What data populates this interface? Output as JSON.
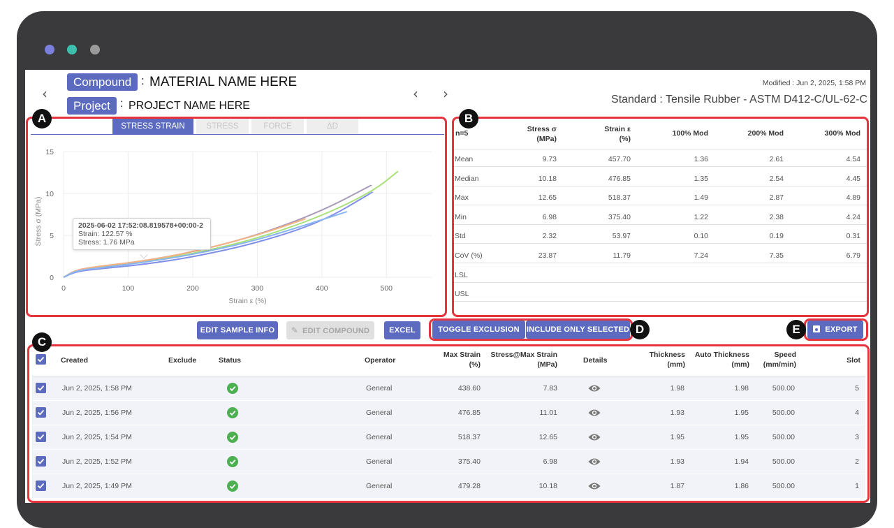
{
  "window": {
    "dots": [
      "#7b7fdc",
      "#3dbfae",
      "#9a9a9a"
    ]
  },
  "header": {
    "compound_label": "Compound",
    "compound_sep": ":",
    "compound_value": "MATERIAL NAME HERE",
    "project_label": "Project",
    "project_sep": ":",
    "project_value": "PROJECT NAME HERE",
    "modified": "Modified : Jun 2, 2025, 1:58 PM",
    "standard": "Standard : Tensile Rubber - ASTM D412-C/UL-62-C"
  },
  "annotations": [
    "A",
    "B",
    "C",
    "D",
    "E"
  ],
  "chart_tabs": [
    "STRESS STRAIN",
    "STRESS",
    "FORCE",
    "ΔD"
  ],
  "chart_data": {
    "type": "line",
    "xlabel": "Strain ε (%)",
    "ylabel": "Stress σ (MPa)",
    "xlim": [
      0,
      570
    ],
    "ylim": [
      0,
      15
    ],
    "xticks": [
      0,
      100,
      200,
      300,
      400,
      500
    ],
    "yticks": [
      0,
      5,
      10,
      15
    ],
    "grid": true,
    "series": [
      {
        "color": "#a8e07a",
        "points": [
          [
            0,
            0
          ],
          [
            20,
            0.9
          ],
          [
            60,
            1.3
          ],
          [
            120,
            1.8
          ],
          [
            200,
            2.8
          ],
          [
            300,
            4.6
          ],
          [
            400,
            7.3
          ],
          [
            480,
            10.3
          ],
          [
            518,
            12.65
          ]
        ]
      },
      {
        "color": "#a89ab8",
        "points": [
          [
            0,
            0
          ],
          [
            20,
            0.9
          ],
          [
            60,
            1.35
          ],
          [
            120,
            1.9
          ],
          [
            200,
            3.0
          ],
          [
            300,
            5.0
          ],
          [
            400,
            7.9
          ],
          [
            477,
            11.0
          ]
        ]
      },
      {
        "color": "#f4b183",
        "points": [
          [
            0,
            0
          ],
          [
            20,
            0.9
          ],
          [
            60,
            1.35
          ],
          [
            120,
            1.9
          ],
          [
            200,
            3.0
          ],
          [
            300,
            5.0
          ],
          [
            375,
            6.98
          ]
        ]
      },
      {
        "color": "#7f8ee8",
        "points": [
          [
            0,
            0
          ],
          [
            20,
            0.7
          ],
          [
            60,
            1.05
          ],
          [
            120,
            1.5
          ],
          [
            200,
            2.4
          ],
          [
            300,
            4.1
          ],
          [
            400,
            6.6
          ],
          [
            479,
            10.18
          ]
        ]
      },
      {
        "color": "#8ab6f0",
        "points": [
          [
            0,
            0
          ],
          [
            20,
            0.8
          ],
          [
            60,
            1.15
          ],
          [
            122.57,
            1.76
          ],
          [
            200,
            2.7
          ],
          [
            300,
            4.4
          ],
          [
            439,
            7.83
          ]
        ]
      }
    ],
    "tooltip": {
      "title": "2025-06-02 17:52:08.819578+00:00-2",
      "strain": "Strain: 122.57 %",
      "stress": "Stress: 1.76 MPa",
      "x": 122.57,
      "y": 1.76
    }
  },
  "stats": {
    "n_label": "n=5",
    "columns": [
      {
        "line1": "Stress σ",
        "line2": "(MPa)"
      },
      {
        "line1": "Strain ε",
        "line2": "(%)"
      },
      {
        "line1": "100% Mod",
        "line2": ""
      },
      {
        "line1": "200% Mod",
        "line2": ""
      },
      {
        "line1": "300% Mod",
        "line2": ""
      }
    ],
    "rows": [
      {
        "label": "Mean",
        "values": [
          "9.73",
          "457.70",
          "1.36",
          "2.61",
          "4.54"
        ]
      },
      {
        "label": "Median",
        "values": [
          "10.18",
          "476.85",
          "1.35",
          "2.54",
          "4.45"
        ]
      },
      {
        "label": "Max",
        "values": [
          "12.65",
          "518.37",
          "1.49",
          "2.87",
          "4.89"
        ]
      },
      {
        "label": "Min",
        "values": [
          "6.98",
          "375.40",
          "1.22",
          "2.38",
          "4.24"
        ]
      },
      {
        "label": "Std",
        "values": [
          "2.32",
          "53.97",
          "0.10",
          "0.19",
          "0.31"
        ]
      },
      {
        "label": "CoV (%)",
        "values": [
          "23.87",
          "11.79",
          "7.24",
          "7.35",
          "6.79"
        ]
      },
      {
        "label": "LSL",
        "values": [
          "",
          "",
          "",
          "",
          ""
        ]
      },
      {
        "label": "USL",
        "values": [
          "",
          "",
          "",
          "",
          ""
        ]
      }
    ]
  },
  "actions": {
    "edit_sample_info": "EDIT SAMPLE INFO",
    "edit_compound": "EDIT COMPOUND",
    "excel": "EXCEL",
    "toggle_exclusion": "TOGGLE EXCLUSION",
    "include_only_selected": "INCLUDE ONLY SELECTED",
    "export": "EXPORT"
  },
  "samples": {
    "columns": {
      "created": "Created",
      "exclude": "Exclude",
      "status": "Status",
      "operator": "Operator",
      "max_strain": [
        "Max Strain",
        "(%)"
      ],
      "stress_at_max": [
        "Stress@Max Strain",
        "(MPa)"
      ],
      "details": "Details",
      "thickness": [
        "Thickness",
        "(mm)"
      ],
      "auto_thickness": [
        "Auto Thickness",
        "(mm)"
      ],
      "speed": [
        "Speed",
        "(mm/min)"
      ],
      "slot": "Slot"
    },
    "rows": [
      {
        "created": "Jun 2, 2025, 1:58 PM",
        "operator": "General",
        "max_strain": "438.60",
        "stress": "7.83",
        "thickness": "1.98",
        "auto_thickness": "1.98",
        "speed": "500.00",
        "slot": "5"
      },
      {
        "created": "Jun 2, 2025, 1:56 PM",
        "operator": "General",
        "max_strain": "476.85",
        "stress": "11.01",
        "thickness": "1.93",
        "auto_thickness": "1.95",
        "speed": "500.00",
        "slot": "4"
      },
      {
        "created": "Jun 2, 2025, 1:54 PM",
        "operator": "General",
        "max_strain": "518.37",
        "stress": "12.65",
        "thickness": "1.95",
        "auto_thickness": "1.95",
        "speed": "500.00",
        "slot": "3"
      },
      {
        "created": "Jun 2, 2025, 1:52 PM",
        "operator": "General",
        "max_strain": "375.40",
        "stress": "6.98",
        "thickness": "1.93",
        "auto_thickness": "1.94",
        "speed": "500.00",
        "slot": "2"
      },
      {
        "created": "Jun 2, 2025, 1:49 PM",
        "operator": "General",
        "max_strain": "479.28",
        "stress": "10.18",
        "thickness": "1.87",
        "auto_thickness": "1.86",
        "speed": "500.00",
        "slot": "1"
      }
    ]
  }
}
